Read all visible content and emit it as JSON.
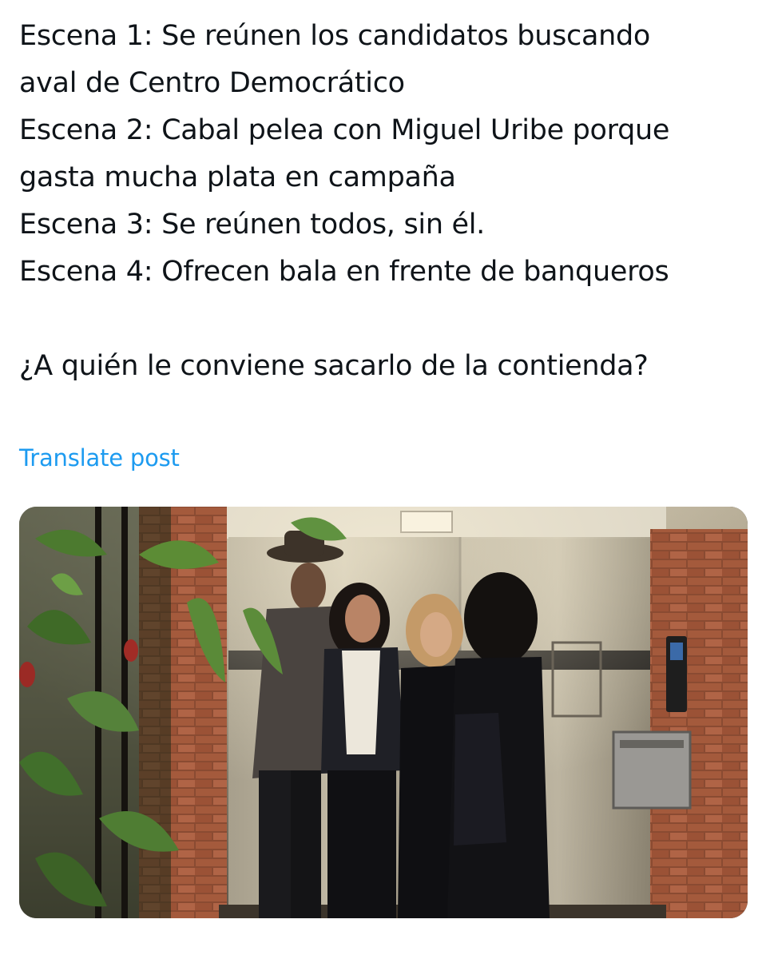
{
  "post": {
    "lines": [
      "Escena 1: Se reúnen los candidatos buscando",
      "aval de Centro Democrático",
      "Escena 2: Cabal pelea con Miguel Uribe porque",
      "gasta mucha plata en campaña",
      "Escena 3: Se reúnen todos, sin él.",
      "Escena 4: Ofrecen bala en frente de banqueros",
      "¿A quién le conviene sacarlo de la contienda?"
    ],
    "translate_label": "Translate post"
  },
  "colors": {
    "text": "#0f1419",
    "link": "#1d9bf0",
    "background": "#ffffff"
  },
  "media": {
    "icon": "photo-icon"
  }
}
